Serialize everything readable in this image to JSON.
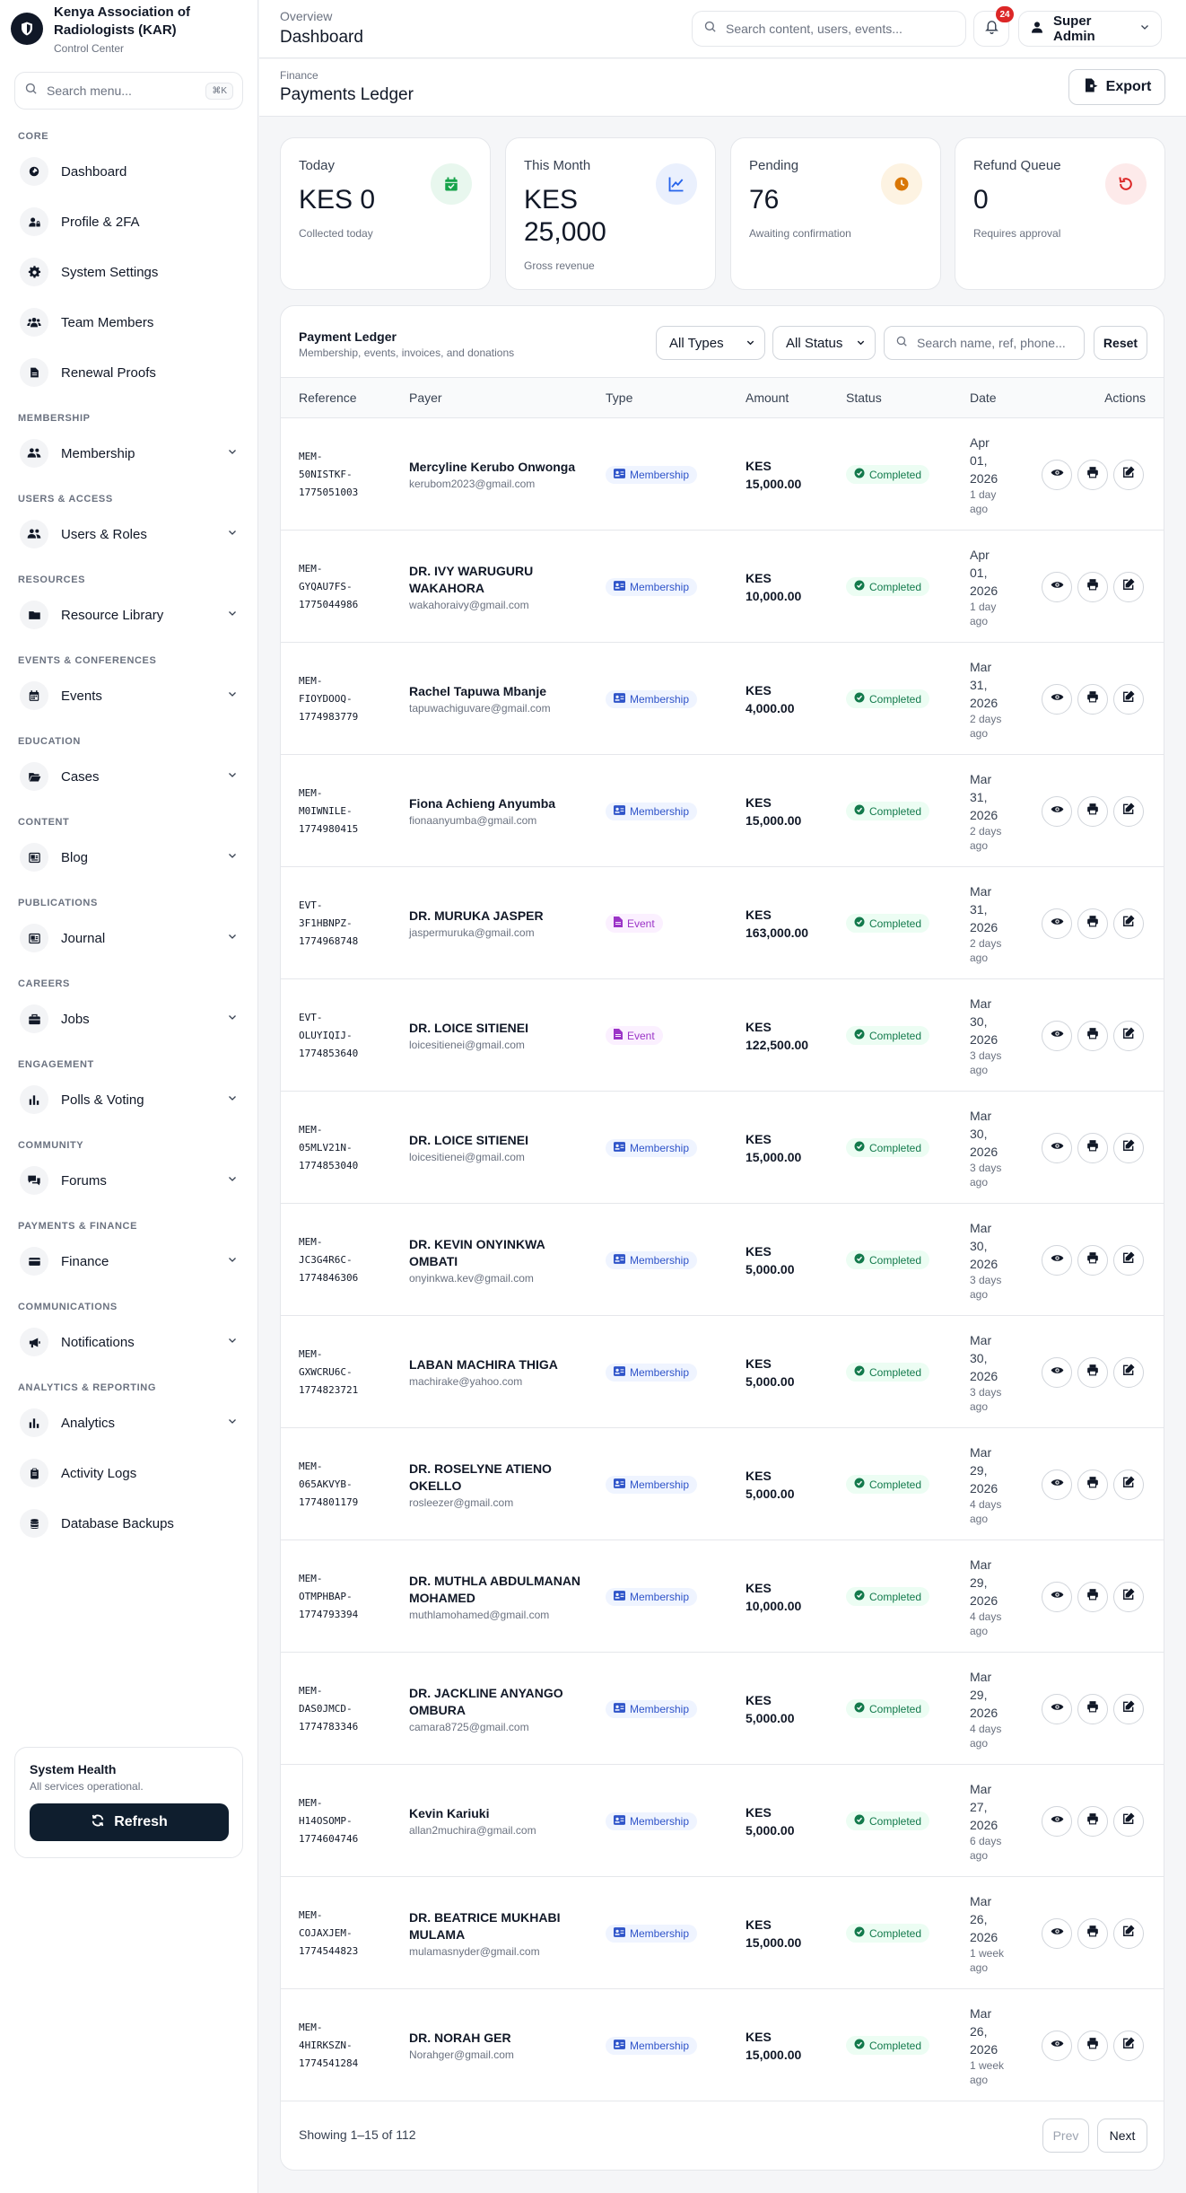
{
  "brand": {
    "name": "Kenya Association of Radiologists (KAR)",
    "sub": "Control Center"
  },
  "menu_search": {
    "placeholder": "Search menu...",
    "shortcut": "⌘K"
  },
  "sidebar": {
    "sections": [
      {
        "label": "CORE",
        "items": [
          {
            "label": "Dashboard",
            "icon": "dashboard-icon"
          },
          {
            "label": "Profile & 2FA",
            "icon": "user-lock-icon"
          },
          {
            "label": "System Settings",
            "icon": "gear-icon"
          },
          {
            "label": "Team Members",
            "icon": "users-icon"
          },
          {
            "label": "Renewal Proofs",
            "icon": "file-icon"
          }
        ]
      },
      {
        "label": "MEMBERSHIP",
        "items": [
          {
            "label": "Membership",
            "icon": "users-cog-icon",
            "expandable": true
          }
        ]
      },
      {
        "label": "USERS & ACCESS",
        "items": [
          {
            "label": "Users & Roles",
            "icon": "users-cog-icon",
            "expandable": true
          }
        ]
      },
      {
        "label": "RESOURCES",
        "items": [
          {
            "label": "Resource Library",
            "icon": "folder-icon",
            "expandable": true
          }
        ]
      },
      {
        "label": "EVENTS & CONFERENCES",
        "items": [
          {
            "label": "Events",
            "icon": "calendar-icon",
            "expandable": true
          }
        ]
      },
      {
        "label": "EDUCATION",
        "items": [
          {
            "label": "Cases",
            "icon": "folder-open-icon",
            "expandable": true
          }
        ]
      },
      {
        "label": "CONTENT",
        "items": [
          {
            "label": "Blog",
            "icon": "newspaper-icon",
            "expandable": true
          }
        ]
      },
      {
        "label": "PUBLICATIONS",
        "items": [
          {
            "label": "Journal",
            "icon": "newspaper-icon",
            "expandable": true
          }
        ]
      },
      {
        "label": "CAREERS",
        "items": [
          {
            "label": "Jobs",
            "icon": "briefcase-icon",
            "expandable": true
          }
        ]
      },
      {
        "label": "ENGAGEMENT",
        "items": [
          {
            "label": "Polls & Voting",
            "icon": "bar-chart-icon",
            "expandable": true
          }
        ]
      },
      {
        "label": "COMMUNITY",
        "items": [
          {
            "label": "Forums",
            "icon": "comments-icon",
            "expandable": true
          }
        ]
      },
      {
        "label": "PAYMENTS & FINANCE",
        "items": [
          {
            "label": "Finance",
            "icon": "credit-card-icon",
            "expandable": true
          }
        ]
      },
      {
        "label": "COMMUNICATIONS",
        "items": [
          {
            "label": "Notifications",
            "icon": "megaphone-icon",
            "expandable": true
          }
        ]
      },
      {
        "label": "ANALYTICS & REPORTING",
        "items": [
          {
            "label": "Analytics",
            "icon": "bar-chart-icon",
            "expandable": true
          },
          {
            "label": "Activity Logs",
            "icon": "clipboard-icon"
          },
          {
            "label": "Database Backups",
            "icon": "database-icon"
          }
        ]
      }
    ]
  },
  "health": {
    "title": "System Health",
    "sub": "All services operational.",
    "refresh_label": "Refresh"
  },
  "topbar": {
    "overline": "Overview",
    "title": "Dashboard",
    "search_placeholder": "Search content, users, events...",
    "notification_count": "24",
    "user_label": "Super Admin"
  },
  "page": {
    "overline": "Finance",
    "title": "Payments Ledger",
    "export_label": "Export"
  },
  "stats": [
    {
      "label": "Today",
      "value": "KES 0",
      "sub": "Collected today",
      "icon": "calendar-check-icon",
      "color": "#16a34a",
      "bg": "#e8f7ee"
    },
    {
      "label": "This Month",
      "value": "KES 25,000",
      "sub": "Gross revenue",
      "icon": "line-chart-icon",
      "color": "#2563eb",
      "bg": "#eaf0fd"
    },
    {
      "label": "Pending",
      "value": "76",
      "sub": "Awaiting confirmation",
      "icon": "clock-icon",
      "color": "#d97706",
      "bg": "#fdf3e2"
    },
    {
      "label": "Refund Queue",
      "value": "0",
      "sub": "Requires approval",
      "icon": "undo-icon",
      "color": "#dc2626",
      "bg": "#fdeaea"
    }
  ],
  "ledger": {
    "title": "Payment Ledger",
    "subtitle": "Membership, events, invoices, and donations",
    "type_filter": "All Types",
    "status_filter": "All Status",
    "search_placeholder": "Search name, ref, phone...",
    "reset_label": "Reset",
    "columns": [
      "Reference",
      "Payer",
      "Type",
      "Amount",
      "Status",
      "Date",
      "Actions"
    ],
    "rows": [
      {
        "ref": "MEM-\n50NISTKF-\n1775051003",
        "name": "Mercyline Kerubo Onwonga",
        "email": "kerubom2023@gmail.com",
        "type": "Membership",
        "amount": "KES\n15,000.00",
        "status": "Completed",
        "date": "Apr\n01,\n2026",
        "rel": "1 day\nago"
      },
      {
        "ref": "MEM-\nGYQAU7FS-\n1775044986",
        "name": "DR. IVY WARUGURU WAKAHORA",
        "email": "wakahoraivy@gmail.com",
        "type": "Membership",
        "amount": "KES\n10,000.00",
        "status": "Completed",
        "date": "Apr\n01,\n2026",
        "rel": "1 day\nago"
      },
      {
        "ref": "MEM-\nFIOYDOOQ-\n1774983779",
        "name": "Rachel Tapuwa Mbanje",
        "email": "tapuwachiguvare@gmail.com",
        "type": "Membership",
        "amount": "KES\n4,000.00",
        "status": "Completed",
        "date": "Mar\n31,\n2026",
        "rel": "2 days\nago"
      },
      {
        "ref": "MEM-\nM0IWNILE-\n1774980415",
        "name": "Fiona Achieng Anyumba",
        "email": "fionaanyumba@gmail.com",
        "type": "Membership",
        "amount": "KES\n15,000.00",
        "status": "Completed",
        "date": "Mar\n31,\n2026",
        "rel": "2 days\nago"
      },
      {
        "ref": "EVT-\n3F1HBNPZ-\n1774968748",
        "name": "DR. MURUKA JASPER",
        "email": "jaspermuruka@gmail.com",
        "type": "Event",
        "amount": "KES\n163,000.00",
        "status": "Completed",
        "date": "Mar\n31,\n2026",
        "rel": "2 days\nago"
      },
      {
        "ref": "EVT-\nOLUYIQIJ-\n1774853640",
        "name": "DR. LOICE SITIENEI",
        "email": "loicesitienei@gmail.com",
        "type": "Event",
        "amount": "KES\n122,500.00",
        "status": "Completed",
        "date": "Mar\n30,\n2026",
        "rel": "3 days\nago"
      },
      {
        "ref": "MEM-\n05MLV21N-\n1774853040",
        "name": "DR. LOICE SITIENEI",
        "email": "loicesitienei@gmail.com",
        "type": "Membership",
        "amount": "KES\n15,000.00",
        "status": "Completed",
        "date": "Mar\n30,\n2026",
        "rel": "3 days\nago"
      },
      {
        "ref": "MEM-\nJC3G4R6C-\n1774846306",
        "name": "DR. KEVIN ONYINKWA OMBATI",
        "email": "onyinkwa.kev@gmail.com",
        "type": "Membership",
        "amount": "KES\n5,000.00",
        "status": "Completed",
        "date": "Mar\n30,\n2026",
        "rel": "3 days\nago"
      },
      {
        "ref": "MEM-\nGXWCRU6C-\n1774823721",
        "name": "LABAN MACHIRA THIGA",
        "email": "machirake@yahoo.com",
        "type": "Membership",
        "amount": "KES\n5,000.00",
        "status": "Completed",
        "date": "Mar\n30,\n2026",
        "rel": "3 days\nago"
      },
      {
        "ref": "MEM-\n065AKVYB-\n1774801179",
        "name": "DR. ROSELYNE ATIENO OKELLO",
        "email": "rosleezer@gmail.com",
        "type": "Membership",
        "amount": "KES\n5,000.00",
        "status": "Completed",
        "date": "Mar\n29,\n2026",
        "rel": "4 days\nago"
      },
      {
        "ref": "MEM-\nOTMPHBAP-\n1774793394",
        "name": "DR. MUTHLA ABDULMANAN MOHAMED",
        "email": "muthlamohamed@gmail.com",
        "type": "Membership",
        "amount": "KES\n10,000.00",
        "status": "Completed",
        "date": "Mar\n29,\n2026",
        "rel": "4 days\nago"
      },
      {
        "ref": "MEM-\nDAS0JMCD-\n1774783346",
        "name": "DR. JACKLINE ANYANGO OMBURA",
        "email": "camara8725@gmail.com",
        "type": "Membership",
        "amount": "KES\n5,000.00",
        "status": "Completed",
        "date": "Mar\n29,\n2026",
        "rel": "4 days\nago"
      },
      {
        "ref": "MEM-\nH14OSOMP-\n1774604746",
        "name": "Kevin Kariuki",
        "email": "allan2muchira@gmail.com",
        "type": "Membership",
        "amount": "KES\n5,000.00",
        "status": "Completed",
        "date": "Mar\n27,\n2026",
        "rel": "6 days\nago"
      },
      {
        "ref": "MEM-\nCOJAXJEM-\n1774544823",
        "name": "DR. BEATRICE MUKHABI MULAMA",
        "email": "mulamasnyder@gmail.com",
        "type": "Membership",
        "amount": "KES\n15,000.00",
        "status": "Completed",
        "date": "Mar\n26,\n2026",
        "rel": "1 week\nago"
      },
      {
        "ref": "MEM-\n4HIRKSZN-\n1774541284",
        "name": "DR. NORAH GER",
        "email": "Norahger@gmail.com",
        "type": "Membership",
        "amount": "KES\n15,000.00",
        "status": "Completed",
        "date": "Mar\n26,\n2026",
        "rel": "1 week\nago"
      }
    ],
    "showing": "Showing 1–15 of 112",
    "prev_label": "Prev",
    "next_label": "Next"
  }
}
